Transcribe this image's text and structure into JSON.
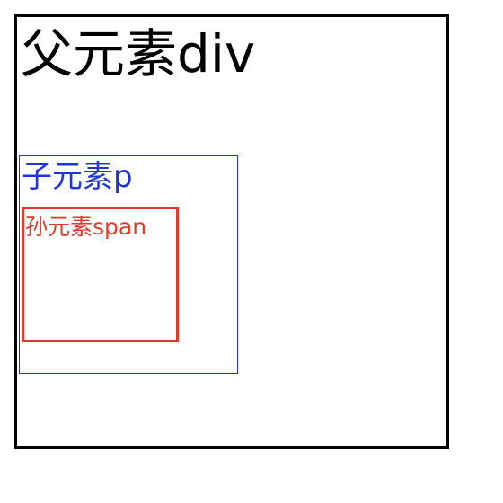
{
  "parent": {
    "label": "父元素div",
    "border_color": "#000000",
    "text_color": "#000000"
  },
  "child": {
    "label": "子元素p",
    "border_color": "#1f35d6",
    "text_color": "#1f35d6"
  },
  "grandchild": {
    "label": "孙元素span",
    "border_color": "#e03a2f",
    "text_color": "#e03a2f"
  }
}
